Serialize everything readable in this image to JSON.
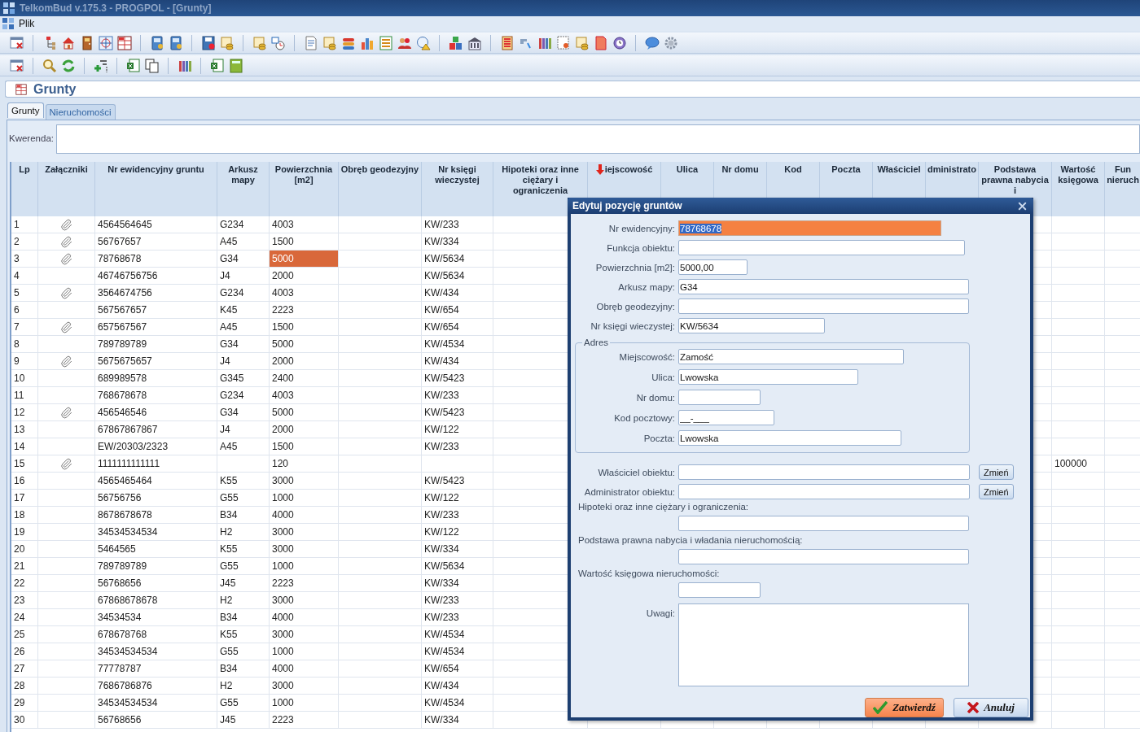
{
  "window": {
    "title": "TelkomBud v.175.3 - PROGPOL - [Grunty]"
  },
  "menu": [
    {
      "label": "Plik"
    }
  ],
  "heading": "Grunty",
  "tabs": [
    {
      "label": "Grunty",
      "selected": true
    },
    {
      "label": "Nieruchomości",
      "selected": false
    }
  ],
  "query": {
    "label": "Kwerenda:"
  },
  "table": {
    "columns": [
      {
        "label": "Lp"
      },
      {
        "label": "Załączniki"
      },
      {
        "label": "Nr ewidencyjny gruntu"
      },
      {
        "label": "Arkusz mapy"
      },
      {
        "label": "Powierzchnia [m2]"
      },
      {
        "label": "Obręb geodezyjny"
      },
      {
        "label": "Nr księgi wieczystej"
      },
      {
        "label": "Hipoteki oraz inne ciężary i ograniczenia"
      },
      {
        "label": "iejscowość",
        "sorted": true
      },
      {
        "label": "Ulica"
      },
      {
        "label": "Nr domu"
      },
      {
        "label": "Kod"
      },
      {
        "label": "Poczta"
      },
      {
        "label": "Właściciel"
      },
      {
        "label": "dministrato"
      },
      {
        "label": "Podstawa prawna nabycia i"
      },
      {
        "label": "Wartość księgowa"
      },
      {
        "label": "Fun nieruch"
      }
    ],
    "rows": [
      {
        "lp": "1",
        "attachment": true,
        "nr": "4564564645",
        "arkusz": "G234",
        "powierzchnia": "4003",
        "kw": "KW/233",
        "selected": false
      },
      {
        "lp": "2",
        "attachment": true,
        "nr": "56767657",
        "arkusz": "A45",
        "powierzchnia": "1500",
        "kw": "KW/334",
        "selected": false
      },
      {
        "lp": "3",
        "attachment": true,
        "nr": "78768678",
        "arkusz": "G34",
        "powierzchnia": "5000",
        "kw": "KW/5634",
        "selected": true
      },
      {
        "lp": "4",
        "attachment": false,
        "nr": "46746756756",
        "arkusz": "J4",
        "powierzchnia": "2000",
        "kw": "KW/5634",
        "selected": false
      },
      {
        "lp": "5",
        "attachment": true,
        "nr": "3564674756",
        "arkusz": "G234",
        "powierzchnia": "4003",
        "kw": "KW/434",
        "selected": false
      },
      {
        "lp": "6",
        "attachment": false,
        "nr": "567567657",
        "arkusz": "K45",
        "powierzchnia": "2223",
        "kw": "KW/654",
        "selected": false
      },
      {
        "lp": "7",
        "attachment": true,
        "nr": "657567567",
        "arkusz": "A45",
        "powierzchnia": "1500",
        "kw": "KW/654",
        "selected": false
      },
      {
        "lp": "8",
        "attachment": false,
        "nr": "789789789",
        "arkusz": "G34",
        "powierzchnia": "5000",
        "kw": "KW/4534",
        "selected": false
      },
      {
        "lp": "9",
        "attachment": true,
        "nr": "5675675657",
        "arkusz": "J4",
        "powierzchnia": "2000",
        "kw": "KW/434",
        "selected": false
      },
      {
        "lp": "10",
        "attachment": false,
        "nr": "689989578",
        "arkusz": "G345",
        "powierzchnia": "2400",
        "kw": "KW/5423",
        "selected": false
      },
      {
        "lp": "11",
        "attachment": false,
        "nr": "768678678",
        "arkusz": "G234",
        "powierzchnia": "4003",
        "kw": "KW/233",
        "selected": false
      },
      {
        "lp": "12",
        "attachment": true,
        "nr": "456546546",
        "arkusz": "G34",
        "powierzchnia": "5000",
        "kw": "KW/5423",
        "selected": false
      },
      {
        "lp": "13",
        "attachment": false,
        "nr": "67867867867",
        "arkusz": "J4",
        "powierzchnia": "2000",
        "kw": "KW/122",
        "selected": false
      },
      {
        "lp": "14",
        "attachment": false,
        "nr": "EW/20303/2323",
        "arkusz": "A45",
        "powierzchnia": "1500",
        "kw": "KW/233",
        "selected": false
      },
      {
        "lp": "15",
        "attachment": true,
        "nr": "1111111111111",
        "powierzchnia": "120",
        "wartosc": "100000",
        "selected": false
      },
      {
        "lp": "16",
        "attachment": false,
        "nr": "4565465464",
        "arkusz": "K55",
        "powierzchnia": "3000",
        "kw": "KW/5423",
        "selected": false
      },
      {
        "lp": "17",
        "attachment": false,
        "nr": "56756756",
        "arkusz": "G55",
        "powierzchnia": "1000",
        "kw": "KW/122",
        "selected": false
      },
      {
        "lp": "18",
        "attachment": false,
        "nr": "8678678678",
        "arkusz": "B34",
        "powierzchnia": "4000",
        "kw": "KW/233",
        "selected": false
      },
      {
        "lp": "19",
        "attachment": false,
        "nr": "34534534534",
        "arkusz": "H2",
        "powierzchnia": "3000",
        "kw": "KW/122",
        "selected": false
      },
      {
        "lp": "20",
        "attachment": false,
        "nr": "5464565",
        "arkusz": "K55",
        "powierzchnia": "3000",
        "kw": "KW/334",
        "selected": false
      },
      {
        "lp": "21",
        "attachment": false,
        "nr": "789789789",
        "arkusz": "G55",
        "powierzchnia": "1000",
        "kw": "KW/5634",
        "selected": false
      },
      {
        "lp": "22",
        "attachment": false,
        "nr": "56768656",
        "arkusz": "J45",
        "powierzchnia": "2223",
        "kw": "KW/334",
        "selected": false
      },
      {
        "lp": "23",
        "attachment": false,
        "nr": "67868678678",
        "arkusz": "H2",
        "powierzchnia": "3000",
        "kw": "KW/233",
        "selected": false
      },
      {
        "lp": "24",
        "attachment": false,
        "nr": "34534534",
        "arkusz": "B34",
        "powierzchnia": "4000",
        "kw": "KW/233",
        "selected": false
      },
      {
        "lp": "25",
        "attachment": false,
        "nr": "678678768",
        "arkusz": "K55",
        "powierzchnia": "3000",
        "kw": "KW/4534",
        "selected": false
      },
      {
        "lp": "26",
        "attachment": false,
        "nr": "34534534534",
        "arkusz": "G55",
        "powierzchnia": "1000",
        "kw": "KW/4534",
        "selected": false
      },
      {
        "lp": "27",
        "attachment": false,
        "nr": "77778787",
        "arkusz": "B34",
        "powierzchnia": "4000",
        "kw": "KW/654",
        "selected": false
      },
      {
        "lp": "28",
        "attachment": false,
        "nr": "7686786876",
        "arkusz": "H2",
        "powierzchnia": "3000",
        "kw": "KW/434",
        "selected": false
      },
      {
        "lp": "29",
        "attachment": false,
        "nr": "34534534534",
        "arkusz": "G55",
        "powierzchnia": "1000",
        "kw": "KW/4534",
        "selected": false
      },
      {
        "lp": "30",
        "attachment": false,
        "nr": "56768656",
        "arkusz": "J45",
        "powierzchnia": "2223",
        "kw": "KW/334",
        "selected": false
      }
    ]
  },
  "dialog": {
    "title": "Edytuj pozycję gruntów",
    "fields": [
      {
        "label": "Nr ewidencyjny:",
        "value": "78768678",
        "focused": true
      },
      {
        "label": "Funkcja obiektu:",
        "focused": false
      },
      {
        "label": "Powierzchnia [m2]:",
        "value": "5000,00",
        "focused": false
      },
      {
        "label": "Arkusz mapy:",
        "value": "G34",
        "focused": false
      },
      {
        "label": "Obręb geodezyjny:",
        "focused": false
      },
      {
        "label": "Nr księgi wieczystej:",
        "value": "KW/5634",
        "focused": false
      }
    ],
    "address": {
      "legend": "Adres",
      "fields": [
        {
          "label": "Miejscowość:",
          "value": "Zamość"
        },
        {
          "label": "Ulica:",
          "value": "Lwowska"
        },
        {
          "label": "Nr domu:"
        },
        {
          "label": "Kod pocztowy:",
          "value": "__-___"
        },
        {
          "label": "Poczta:",
          "value": "Lwowska"
        }
      ]
    },
    "people": [
      {
        "label": "Właściciel obiektu:",
        "button": "Zmień"
      },
      {
        "label": "Administrator obiektu:",
        "button": "Zmień"
      }
    ],
    "stacked": [
      {
        "label": "Hipoteki oraz inne ciężary i ograniczenia:"
      },
      {
        "label": "Podstawa prawna nabycia i władania nieruchomością:"
      },
      {
        "label": "Wartość księgowa nieruchomości:"
      }
    ],
    "notes": {
      "label": "Uwagi:"
    },
    "buttons": [
      {
        "label": "Zatwierdź",
        "kind": "confirm"
      },
      {
        "label": "Anuluj",
        "kind": "cancel"
      }
    ]
  }
}
